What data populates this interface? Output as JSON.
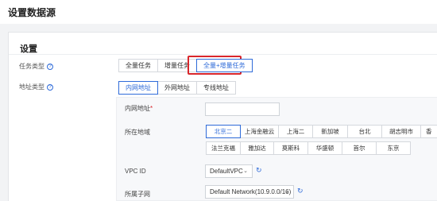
{
  "header": {
    "title": "设置数据源"
  },
  "card": {
    "title": "设置"
  },
  "task_type": {
    "label": "任务类型",
    "options": [
      "全量任务",
      "增量任务",
      "全量+增量任务"
    ],
    "selected": "全量+增量任务"
  },
  "address_type": {
    "label": "地址类型",
    "options": [
      "内网地址",
      "外网地址",
      "专线地址"
    ],
    "selected": "内网地址"
  },
  "intranet": {
    "label": "内网地址",
    "required_mark": "*",
    "value": ""
  },
  "region": {
    "label": "所在地域",
    "row1": [
      "北京二",
      "上海金融云",
      "上海二",
      "新加坡",
      "台北",
      "胡志明市",
      "香"
    ],
    "row2": [
      "法兰克福",
      "雅加达",
      "莫斯科",
      "华盛顿",
      "首尔",
      "东京"
    ],
    "selected": "北京二"
  },
  "vpc": {
    "label": "VPC ID",
    "value": "DefaultVPC"
  },
  "subnet": {
    "label": "所属子网",
    "value": "Default Network(10.9.0.0/16)"
  },
  "icons": {
    "help": "help-circle-icon",
    "chevron": "chevron-down-icon",
    "refresh": "refresh-icon"
  },
  "colors": {
    "accent": "#2f6bd9",
    "highlight": "#d9262b"
  }
}
